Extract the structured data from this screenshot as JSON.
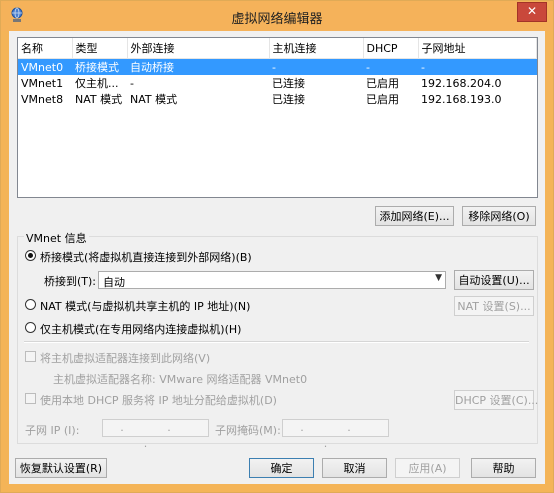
{
  "window": {
    "title": "虚拟网络编辑器",
    "close_label": "✕"
  },
  "table": {
    "headers": [
      "名称",
      "类型",
      "外部连接",
      "主机连接",
      "DHCP",
      "子网地址"
    ],
    "rows": [
      [
        "VMnet0",
        "桥接模式",
        "自动桥接",
        "-",
        "-",
        "-"
      ],
      [
        "VMnet1",
        "仅主机...",
        "-",
        "已连接",
        "已启用",
        "192.168.204.0"
      ],
      [
        "VMnet8",
        "NAT 模式",
        "NAT 模式",
        "已连接",
        "已启用",
        "192.168.193.0"
      ]
    ],
    "selected_row": 0
  },
  "buttons": {
    "add_network": "添加网络(E)...",
    "remove_network": "移除网络(O)",
    "auto_settings": "自动设置(U)...",
    "nat_settings": "NAT 设置(S)...",
    "dhcp_settings": "DHCP 设置(C)...",
    "restore_defaults": "恢复默认设置(R)",
    "ok": "确定",
    "cancel": "取消",
    "apply": "应用(A)",
    "help": "帮助"
  },
  "vmnet_info": {
    "group_title": "VMnet 信息",
    "bridged_label": "桥接模式(将虚拟机直接连接到外部网络)(B)",
    "bridged_to_label": "桥接到(T):",
    "bridged_to_value": "自动",
    "nat_label": "NAT 模式(与虚拟机共享主机的 IP 地址)(N)",
    "hostonly_label": "仅主机模式(在专用网络内连接虚拟机)(H)",
    "connect_adapter_label": "将主机虚拟适配器连接到此网络(V)",
    "adapter_name_label": "主机虚拟适配器名称: VMware 网络适配器 VMnet0",
    "dhcp_label": "使用本地 DHCP 服务将 IP 地址分配给虚拟机(D)",
    "subnet_ip_label": "子网 IP (I):",
    "subnet_mask_label": "子网掩码(M):",
    "ip_placeholder": ". . .",
    "selected_mode": "bridged"
  }
}
